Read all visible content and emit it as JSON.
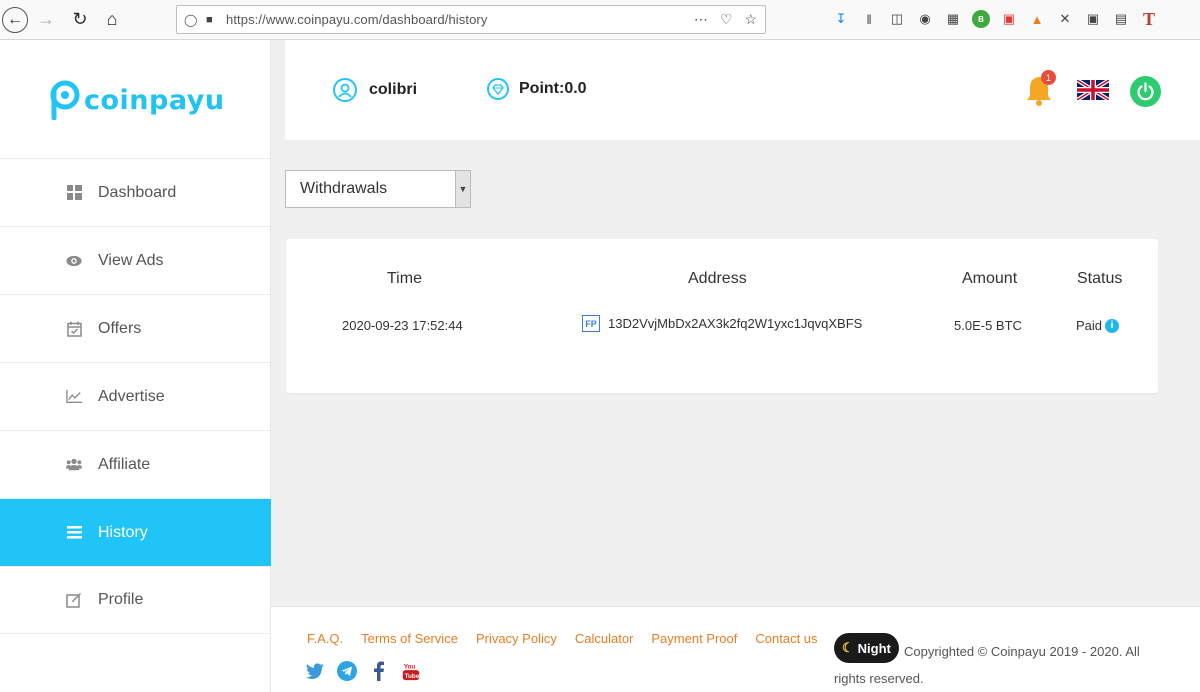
{
  "browser": {
    "url": "https://www.coinpayu.com/dashboard/history"
  },
  "brand": {
    "name": "coinpayu",
    "accent": "#21c4f7"
  },
  "sidebar": {
    "items": [
      {
        "label": "Dashboard",
        "icon": "dashboard-icon"
      },
      {
        "label": "View Ads",
        "icon": "eye-icon"
      },
      {
        "label": "Offers",
        "icon": "calendar-check-icon"
      },
      {
        "label": "Advertise",
        "icon": "line-chart-icon"
      },
      {
        "label": "Affiliate",
        "icon": "users-icon"
      },
      {
        "label": "History",
        "icon": "list-icon",
        "active": true
      },
      {
        "label": "Profile",
        "icon": "edit-icon"
      }
    ]
  },
  "header": {
    "username": "colibri",
    "points": "Point:0.0",
    "notification_count": "1"
  },
  "filter": {
    "selected": "Withdrawals"
  },
  "table": {
    "columns": [
      "Time",
      "Address",
      "Amount",
      "Status"
    ],
    "rows": [
      {
        "time": "2020-09-23 17:52:44",
        "address_badge": "FP",
        "address": "13D2VvjMbDx2AX3k2fq2W1yxc1JqvqXBFS",
        "amount": "5.0E-5 BTC",
        "status": "Paid",
        "status_info": "i"
      }
    ]
  },
  "footer": {
    "links": [
      "F.A.Q.",
      "Terms of Service",
      "Privacy Policy",
      "Calculator",
      "Payment Proof",
      "Contact us"
    ],
    "night_label": "Night",
    "copyright": "Copyrighted © Coinpayu 2019 - 2020. All rights reserved."
  }
}
